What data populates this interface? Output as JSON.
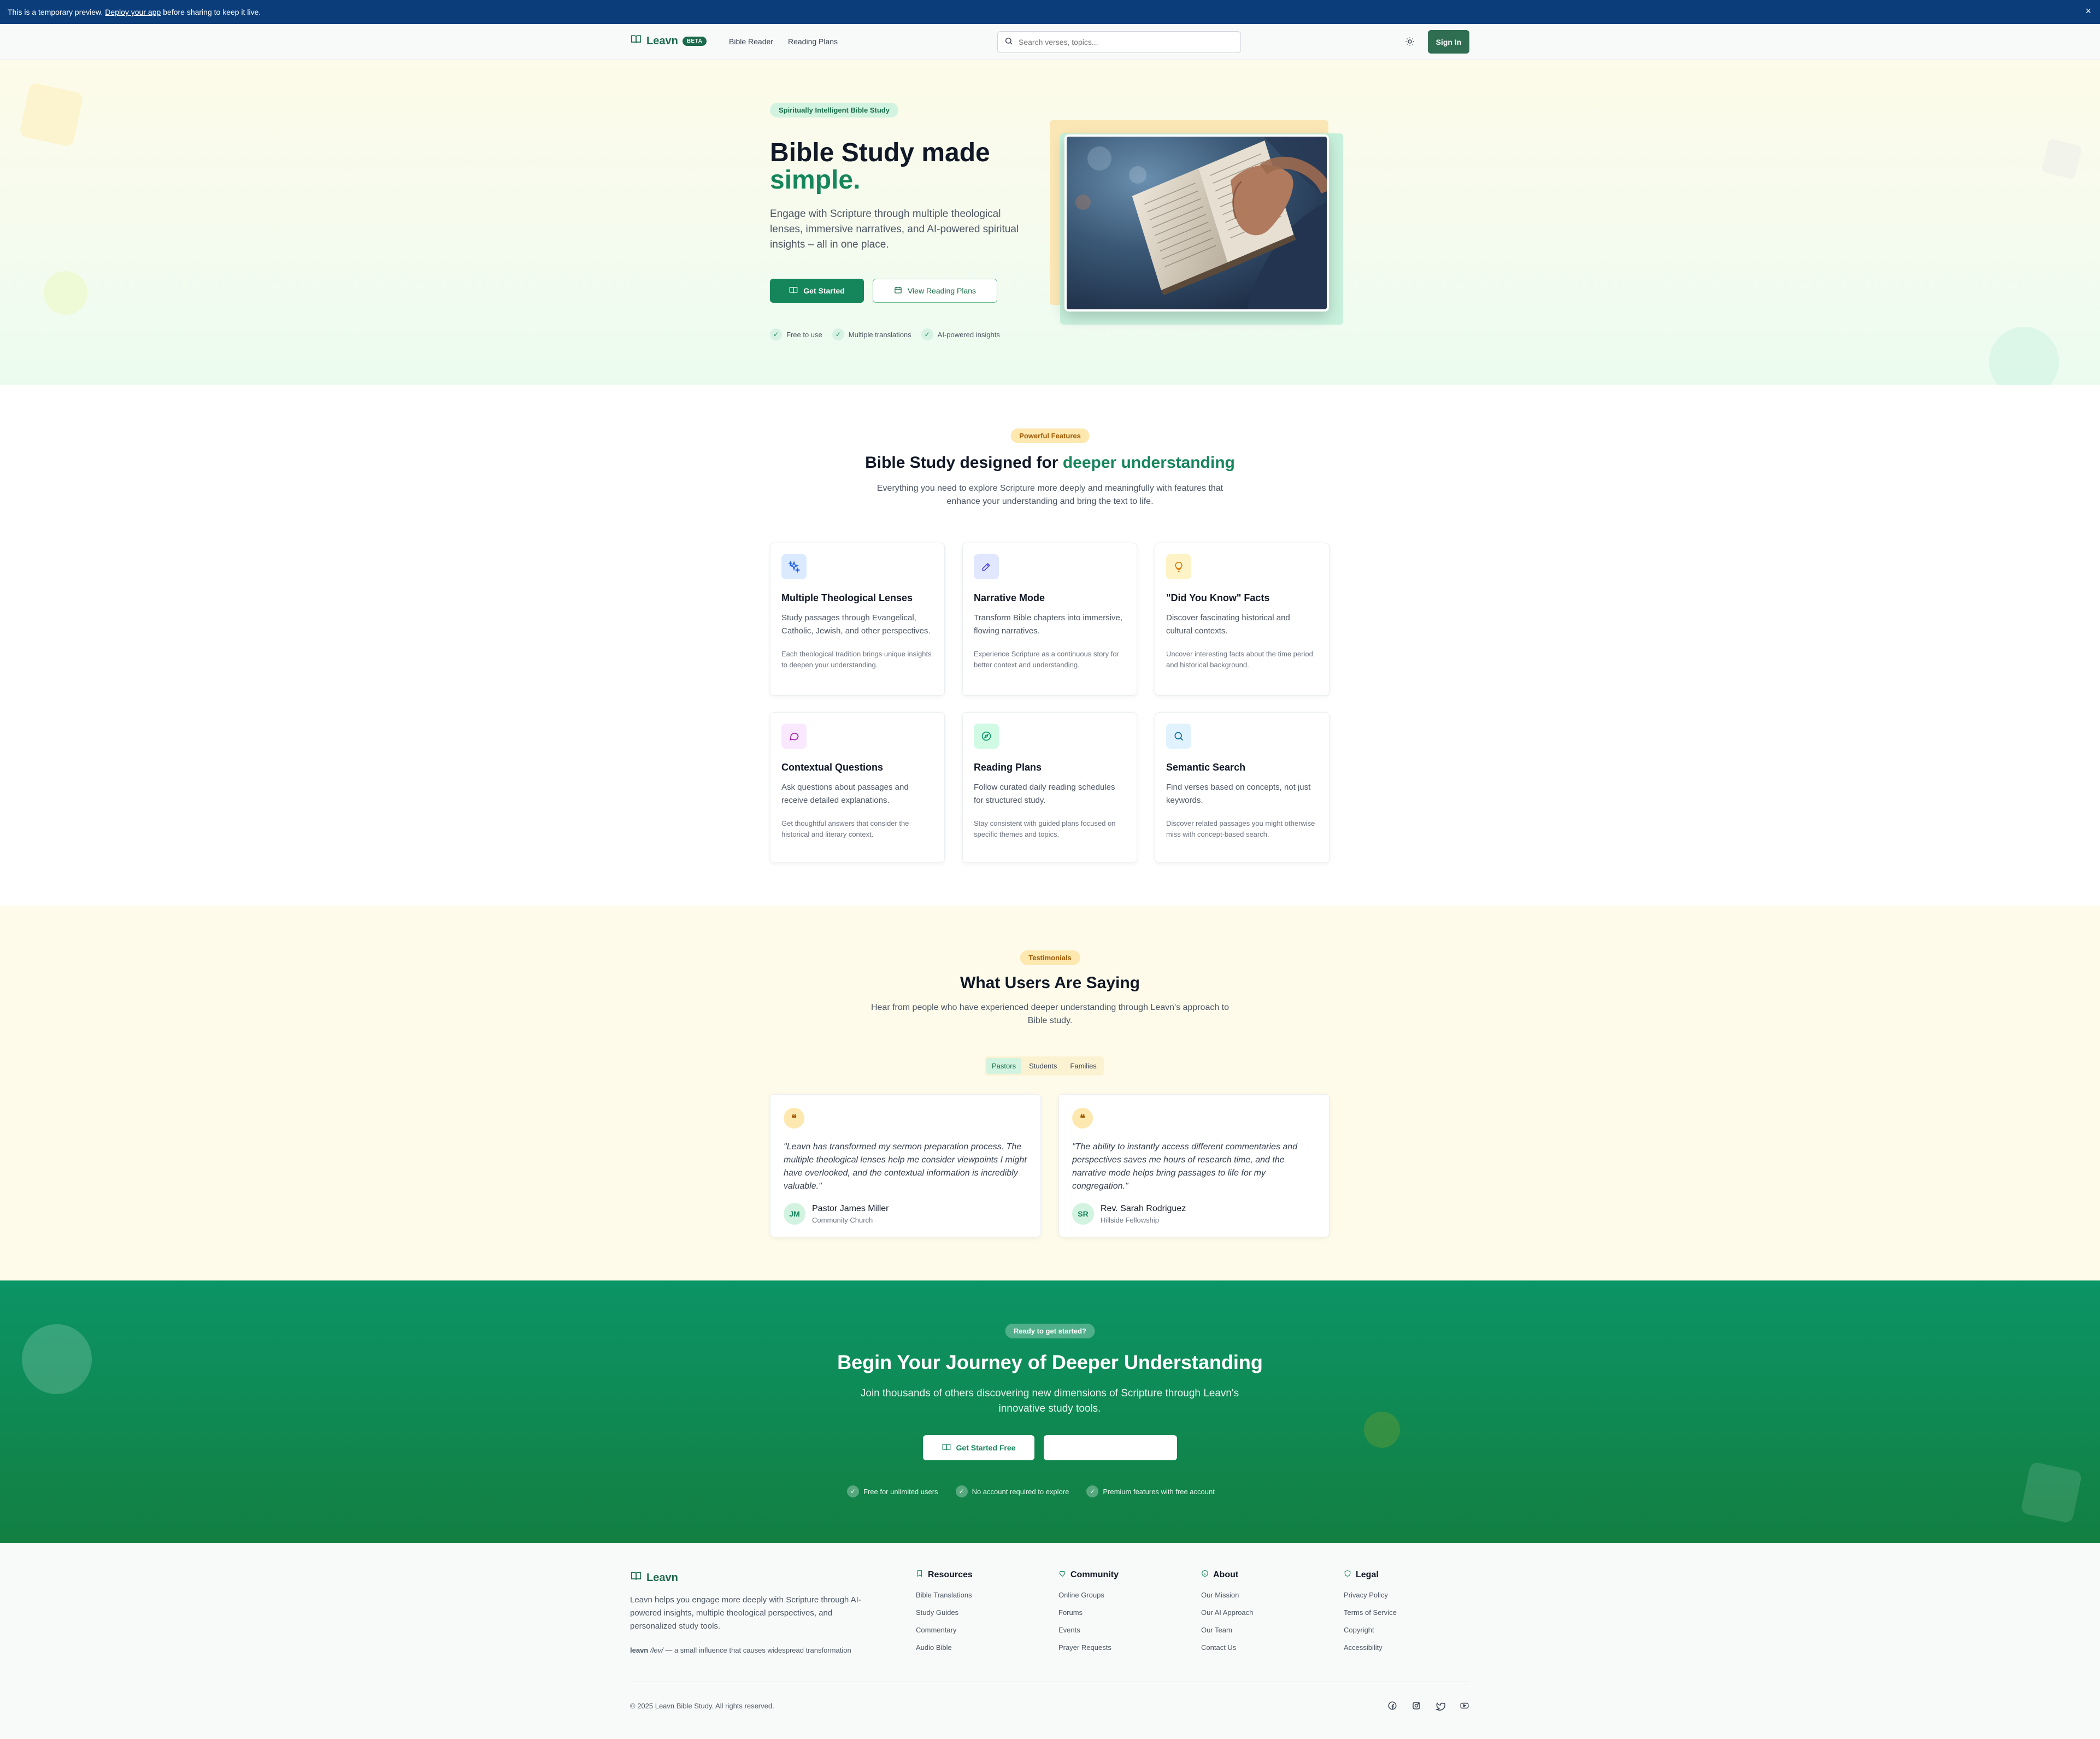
{
  "banner": {
    "text_before": "This is a temporary preview.",
    "link": "Deploy your app",
    "text_after": "before sharing to keep it live.",
    "close": "×"
  },
  "header": {
    "brand": "Leavn",
    "badge": "BETA",
    "nav": [
      "Bible Reader",
      "Reading Plans"
    ],
    "search_placeholder": "Search verses, topics...",
    "sign_in": "Sign In"
  },
  "hero": {
    "pill": "Spiritually Intelligent Bible Study",
    "title_line1": "Bible Study made",
    "title_line2": "simple.",
    "subtitle": "Engage with Scripture through multiple theological lenses, immersive narratives, and AI-powered spiritual insights – all in one place.",
    "primary_button": "Get Started",
    "secondary_button": "View Reading Plans",
    "checks": [
      "Free to use",
      "Multiple translations",
      "AI-powered insights"
    ]
  },
  "features": {
    "pill": "Powerful Features",
    "title_plain": "Bible Study designed for",
    "title_accent": "deeper understanding",
    "subtitle": "Everything you need to explore Scripture more deeply and meaningfully with features that enhance your understanding and bring the text to life.",
    "cards": [
      {
        "icon": "sparkles-icon",
        "title": "Multiple Theological Lenses",
        "desc": "Study passages through Evangelical, Catholic, Jewish, and other perspectives.",
        "note": "Each theological tradition brings unique insights to deepen your understanding."
      },
      {
        "icon": "pencil-icon",
        "title": "Narrative Mode",
        "desc": "Transform Bible chapters into immersive, flowing narratives.",
        "note": "Experience Scripture as a continuous story for better context and understanding."
      },
      {
        "icon": "lightbulb-icon",
        "title": "\"Did You Know\" Facts",
        "desc": "Discover fascinating historical and cultural contexts.",
        "note": "Uncover interesting facts about the time period and historical background."
      },
      {
        "icon": "chat-bubble-icon",
        "title": "Contextual Questions",
        "desc": "Ask questions about passages and receive detailed explanations.",
        "note": "Get thoughtful answers that consider the historical and literary context."
      },
      {
        "icon": "compass-icon",
        "title": "Reading Plans",
        "desc": "Follow curated daily reading schedules for structured study.",
        "note": "Stay consistent with guided plans focused on specific themes and topics."
      },
      {
        "icon": "search-icon",
        "title": "Semantic Search",
        "desc": "Find verses based on concepts, not just keywords.",
        "note": "Discover related passages you might otherwise miss with concept-based search."
      }
    ]
  },
  "testimonials": {
    "pill": "Testimonials",
    "title": "What Users Are Saying",
    "subtitle": "Hear from people who have experienced deeper understanding through Leavn's approach to Bible study.",
    "tabs": [
      "Pastors",
      "Students",
      "Families"
    ],
    "active_tab": "Pastors",
    "items": [
      {
        "mark": "❝",
        "quote": "\"Leavn has transformed my sermon preparation process. The multiple theological lenses help me consider viewpoints I might have overlooked, and the contextual information is incredibly valuable.\"",
        "initials": "JM",
        "name": "Pastor James Miller",
        "org": "Community Church"
      },
      {
        "mark": "❝",
        "quote": "\"The ability to instantly access different commentaries and perspectives saves me hours of research time, and the narrative mode helps bring passages to life for my congregation.\"",
        "initials": "SR",
        "name": "Rev. Sarah Rodriguez",
        "org": "Hillside Fellowship"
      }
    ]
  },
  "cta": {
    "pill": "Ready to get started?",
    "title": "Begin Your Journey of Deeper Understanding",
    "subtitle": "Join thousands of others discovering new dimensions of Scripture through Leavn's innovative study tools.",
    "primary_button": "Get Started Free",
    "checks": [
      "Free for unlimited users",
      "No account required to explore",
      "Premium features with free account"
    ]
  },
  "footer": {
    "brand": "Leavn",
    "description": "Leavn helps you engage more deeply with Scripture through AI-powered insights, multiple theological perspectives, and personalized study tools.",
    "note_word": "leavn",
    "note_pron": "/lev/",
    "note_rest": "— a small influence that causes widespread transformation",
    "columns": [
      {
        "icon": "bookmark-icon",
        "title": "Resources",
        "links": [
          "Bible Translations",
          "Study Guides",
          "Commentary",
          "Audio Bible"
        ]
      },
      {
        "icon": "heart-icon",
        "title": "Community",
        "links": [
          "Online Groups",
          "Forums",
          "Events",
          "Prayer Requests"
        ]
      },
      {
        "icon": "info-icon",
        "title": "About",
        "links": [
          "Our Mission",
          "Our AI Approach",
          "Our Team",
          "Contact Us"
        ]
      },
      {
        "icon": "shield-icon",
        "title": "Legal",
        "links": [
          "Privacy Policy",
          "Terms of Service",
          "Copyright",
          "Accessibility"
        ]
      }
    ],
    "copyright": "© 2025 Leavn Bible Study. All rights reserved.",
    "socials": [
      "facebook-icon",
      "instagram-icon",
      "twitter-icon",
      "youtube-icon"
    ]
  },
  "colors": {
    "brand": "#15865b",
    "banner": "#0a3d7a",
    "accent_yellow": "#fde8b0"
  }
}
